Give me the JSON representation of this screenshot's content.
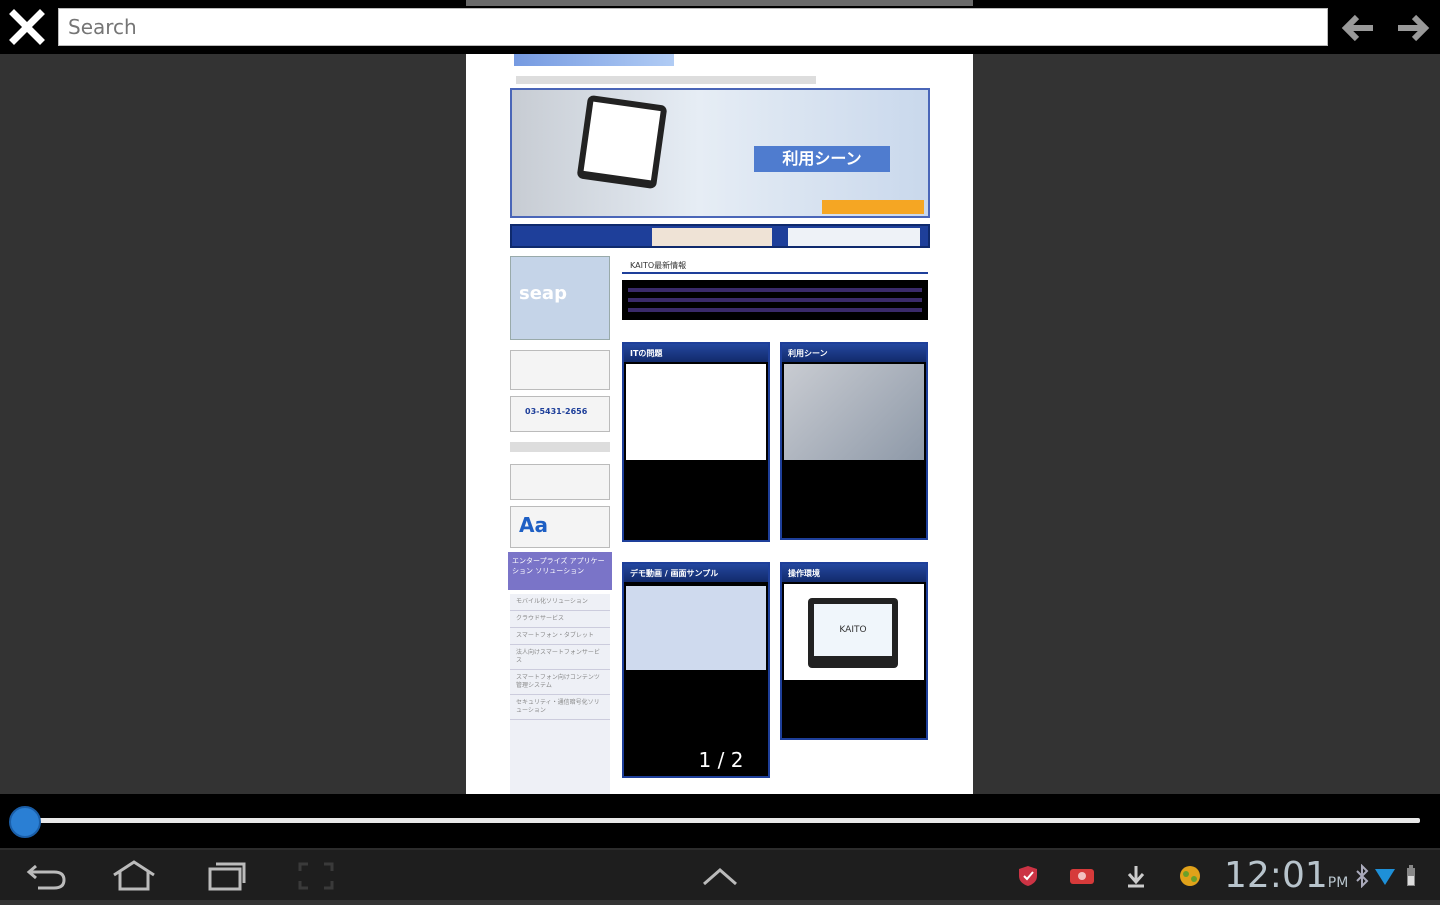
{
  "search": {
    "placeholder": "Search"
  },
  "pager": {
    "indicator": "1 / 2"
  },
  "clock": {
    "time": "12:01",
    "ampm": "PM"
  },
  "preview": {
    "hero_button": "利用シーン",
    "phone": "03-5431-2656",
    "sections": [
      "ITの問題",
      "利用シーン",
      "デモ動画 / 画面サンプル",
      "操作環境"
    ],
    "side_banner": "エンタープライズ アプリケーション ソリューション",
    "side_links": [
      "モバイル化ソリューション",
      "クラウドサービス",
      "スマートフォン・タブレット",
      "法人向けスマートフォンサービス",
      "スマートフォン向けコンテンツ管理システム",
      "セキュリティ・通信暗号化ソリューション"
    ],
    "logo_text": "KAITO",
    "news_head": "KAITO最新情報"
  },
  "colors": {
    "accent": "#2a7fd4",
    "dark_bg": "#333333",
    "brand_blue": "#23479e"
  }
}
